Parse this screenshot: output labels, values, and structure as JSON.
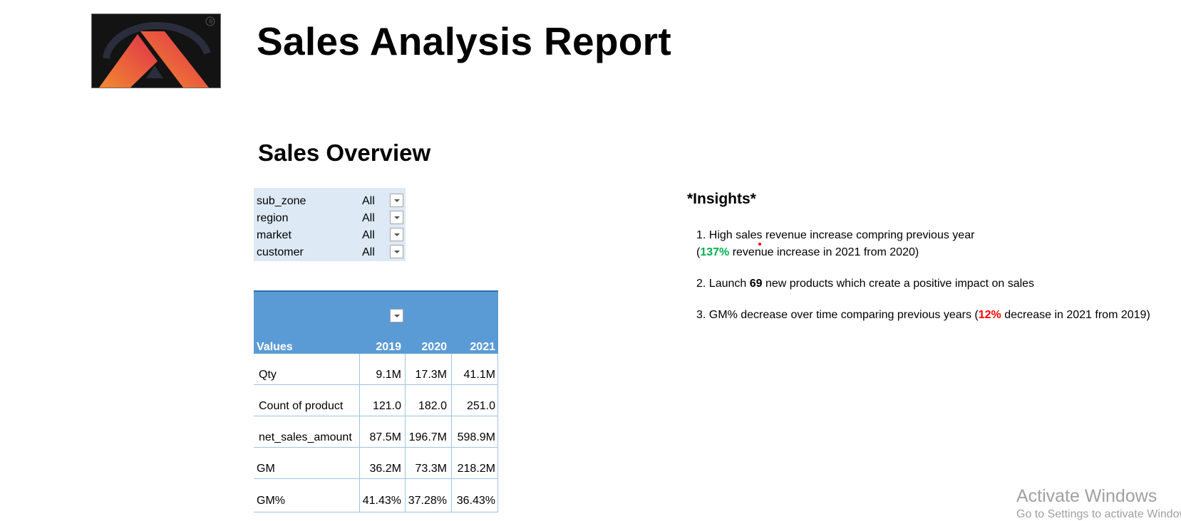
{
  "report": {
    "title": "Sales Analysis Report",
    "section": "Sales Overview"
  },
  "logo": {
    "mark": "®"
  },
  "filters": [
    {
      "field": "sub_zone",
      "value": "All"
    },
    {
      "field": "region",
      "value": "All"
    },
    {
      "field": "market",
      "value": "All"
    },
    {
      "field": "customer",
      "value": "All"
    }
  ],
  "pivot": {
    "header": {
      "values_label": "Values",
      "years": [
        "2019",
        "2020",
        "2021"
      ]
    },
    "rows": [
      {
        "label": "Qty",
        "cells": [
          "9.1M",
          "17.3M",
          "41.1M"
        ]
      },
      {
        "label": "Count of product",
        "cells": [
          "121.0",
          "182.0",
          "251.0"
        ]
      },
      {
        "label": "net_sales_amount",
        "cells": [
          "87.5M",
          "196.7M",
          "598.9M"
        ]
      },
      {
        "label": "GM",
        "cells": [
          "36.2M",
          "73.3M",
          "218.2M"
        ]
      },
      {
        "label": "GM%",
        "cells": [
          "41.43%",
          "37.28%",
          "36.43%"
        ]
      }
    ]
  },
  "insights": {
    "title": "*Insights*",
    "i1_line1": "1. High sales revenue increase compring previous year",
    "i1_open": "(",
    "i1_pct": "137%",
    "i1_rest": " revenue increase in 2021 from 2020)",
    "i2_pre": "2. Launch ",
    "i2_num": "69",
    "i2_post": " new products which create a positive impact on sales",
    "i3_pre": "3. GM% decrease over time comparing previous years  (",
    "i3_pct": "12%",
    "i3_post": " decrease in 2021 from 2019)"
  },
  "watermark": {
    "line1": "Activate Windows",
    "line2": "Go to Settings to activate Windows."
  },
  "colors": {
    "pivot_header": "#5b9bd5",
    "filter_bg": "#dde9f5",
    "positive": "#00b050",
    "negative": "#ff0000"
  }
}
